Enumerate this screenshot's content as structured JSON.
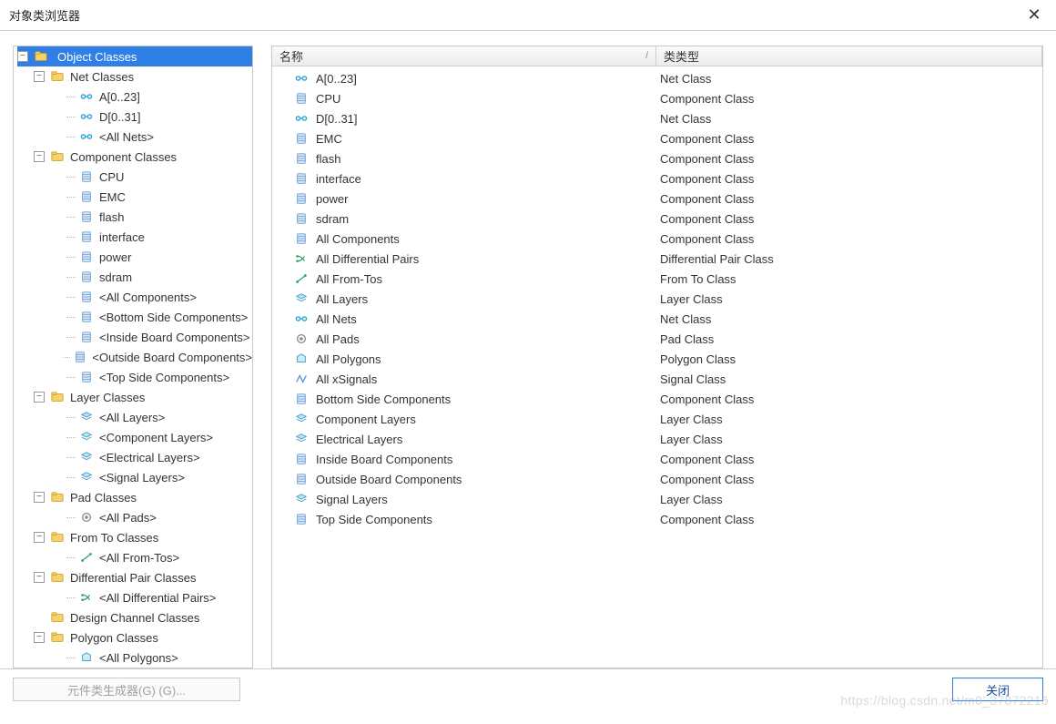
{
  "window": {
    "title": "对象类浏览器"
  },
  "tree": {
    "root_label": "Object Classes",
    "nodes": [
      {
        "label": "Net Classes",
        "icon": "folder",
        "expand": "-",
        "children": [
          {
            "label": "A[0..23]",
            "icon": "net"
          },
          {
            "label": "D[0..31]",
            "icon": "net"
          },
          {
            "label": "<All Nets>",
            "icon": "net"
          }
        ]
      },
      {
        "label": "Component Classes",
        "icon": "folder",
        "expand": "-",
        "children": [
          {
            "label": "CPU",
            "icon": "comp"
          },
          {
            "label": "EMC",
            "icon": "comp"
          },
          {
            "label": "flash",
            "icon": "comp"
          },
          {
            "label": "interface",
            "icon": "comp"
          },
          {
            "label": "power",
            "icon": "comp"
          },
          {
            "label": "sdram",
            "icon": "comp"
          },
          {
            "label": "<All Components>",
            "icon": "comp"
          },
          {
            "label": "<Bottom Side Components>",
            "icon": "comp"
          },
          {
            "label": "<Inside Board Components>",
            "icon": "comp"
          },
          {
            "label": "<Outside Board Components>",
            "icon": "comp"
          },
          {
            "label": "<Top Side Components>",
            "icon": "comp"
          }
        ]
      },
      {
        "label": "Layer Classes",
        "icon": "folder",
        "expand": "-",
        "children": [
          {
            "label": "<All Layers>",
            "icon": "layer"
          },
          {
            "label": "<Component Layers>",
            "icon": "layer"
          },
          {
            "label": "<Electrical Layers>",
            "icon": "layer"
          },
          {
            "label": "<Signal Layers>",
            "icon": "layer"
          }
        ]
      },
      {
        "label": "Pad Classes",
        "icon": "folder",
        "expand": "-",
        "children": [
          {
            "label": "<All Pads>",
            "icon": "pad"
          }
        ]
      },
      {
        "label": "From To Classes",
        "icon": "folder",
        "expand": "-",
        "children": [
          {
            "label": "<All From-Tos>",
            "icon": "fromto"
          }
        ]
      },
      {
        "label": "Differential Pair Classes",
        "icon": "folder",
        "expand": "-",
        "children": [
          {
            "label": "<All Differential Pairs>",
            "icon": "diff"
          }
        ]
      },
      {
        "label": "Design Channel Classes",
        "icon": "folder",
        "expand": ""
      },
      {
        "label": "Polygon Classes",
        "icon": "folder",
        "expand": "-",
        "children": [
          {
            "label": "<All Polygons>",
            "icon": "poly"
          }
        ]
      }
    ]
  },
  "list": {
    "header": {
      "name": "名称",
      "type": "类类型"
    },
    "rows": [
      {
        "name": "A[0..23]",
        "icon": "net",
        "type": "Net Class"
      },
      {
        "name": "CPU",
        "icon": "comp",
        "type": "Component Class"
      },
      {
        "name": "D[0..31]",
        "icon": "net",
        "type": "Net Class"
      },
      {
        "name": "EMC",
        "icon": "comp",
        "type": "Component Class"
      },
      {
        "name": "flash",
        "icon": "comp",
        "type": "Component Class"
      },
      {
        "name": "interface",
        "icon": "comp",
        "type": "Component Class"
      },
      {
        "name": "power",
        "icon": "comp",
        "type": "Component Class"
      },
      {
        "name": "sdram",
        "icon": "comp",
        "type": "Component Class"
      },
      {
        "name": "All Components",
        "icon": "comp",
        "type": "Component Class"
      },
      {
        "name": "All Differential Pairs",
        "icon": "diff",
        "type": "Differential Pair Class"
      },
      {
        "name": "All From-Tos",
        "icon": "fromto",
        "type": "From To Class"
      },
      {
        "name": "All Layers",
        "icon": "layer",
        "type": "Layer Class"
      },
      {
        "name": "All Nets",
        "icon": "net",
        "type": "Net Class"
      },
      {
        "name": "All Pads",
        "icon": "pad",
        "type": "Pad Class"
      },
      {
        "name": "All Polygons",
        "icon": "poly",
        "type": "Polygon Class"
      },
      {
        "name": "All xSignals",
        "icon": "xsig",
        "type": "Signal Class"
      },
      {
        "name": "Bottom Side Components",
        "icon": "comp",
        "type": "Component Class"
      },
      {
        "name": "Component Layers",
        "icon": "layer",
        "type": "Layer Class"
      },
      {
        "name": "Electrical Layers",
        "icon": "layer",
        "type": "Layer Class"
      },
      {
        "name": "Inside Board Components",
        "icon": "comp",
        "type": "Component Class"
      },
      {
        "name": "Outside Board Components",
        "icon": "comp",
        "type": "Component Class"
      },
      {
        "name": "Signal Layers",
        "icon": "layer",
        "type": "Layer Class"
      },
      {
        "name": "Top Side Components",
        "icon": "comp",
        "type": "Component Class"
      }
    ]
  },
  "footer": {
    "gen_button": "元件类生成器(G) (G)...",
    "close_button": "关闭"
  },
  "watermark": "https://blog.csdn.net/m0_37872216"
}
